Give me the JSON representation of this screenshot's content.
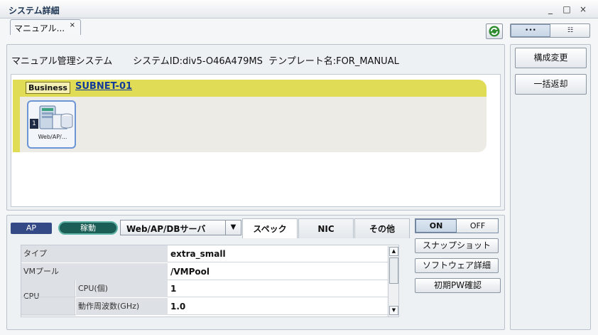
{
  "window": {
    "title": "システム詳細",
    "controls": [
      "_",
      "□",
      "×"
    ]
  },
  "tab": {
    "label": "マニュアル...",
    "close": "×"
  },
  "view_switch": {
    "left": "•••",
    "right": "☷"
  },
  "system_info": {
    "name": "マニュアル管理システム",
    "system_id": "システムID:div5-O46A479MS",
    "template": "テンプレート名:FOR_MANUAL"
  },
  "network": {
    "tag": "Business",
    "subnet": "SUBNET-01",
    "server": {
      "count": "1",
      "label": "Web/AP/..."
    }
  },
  "detail": {
    "role_badge": "AP",
    "status": "稼動",
    "server_select": "Web/AP/DBサーバ",
    "tabs": [
      "スペック",
      "NIC",
      "その他"
    ],
    "active_tab": "スペック",
    "rows": [
      {
        "label": "タイプ",
        "value": "extra_small"
      },
      {
        "label": "VMプール",
        "value": "/VMPool"
      },
      {
        "group": "CPU",
        "label": "CPU(個)",
        "value": "1"
      },
      {
        "group": "CPU",
        "label": "動作周波数(GHz)",
        "value": "1.0"
      }
    ]
  },
  "power": {
    "on": "ON",
    "off": "OFF"
  },
  "actions": [
    "スナップショット",
    "ソフトウェア詳細",
    "初期PW確認"
  ],
  "side_actions": [
    "構成変更",
    "一括返却"
  ],
  "colors": {
    "subnet_band": "#e0dc55",
    "role_badge": "#334a87",
    "status_pill": "#1b5e55",
    "link": "#123a9a"
  }
}
